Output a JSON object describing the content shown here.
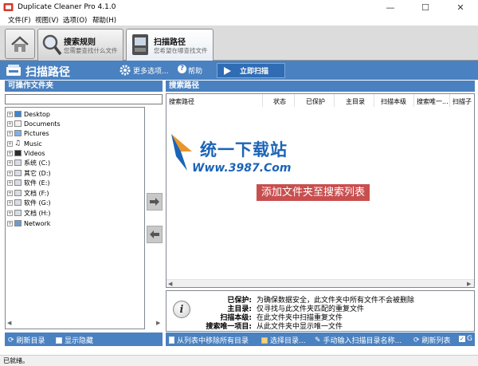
{
  "window": {
    "title": "Duplicate Cleaner Pro 4.1.0",
    "controls": [
      "—",
      "☐",
      "✕"
    ]
  },
  "menu": [
    "文件(F)",
    "视图(V)",
    "选项(O)",
    "帮助(H)"
  ],
  "ribbon": {
    "tabs": [
      {
        "title": "搜索规则",
        "subtitle": "您需要查找什么文件"
      },
      {
        "title": "扫描路径",
        "subtitle": "您希望在哪查找文件"
      }
    ]
  },
  "command_bar": {
    "title": "扫描路径",
    "more_options": "更多选项...",
    "help": "帮助",
    "scan_button": "立即扫描"
  },
  "left_panel": {
    "header": "可操作文件夹",
    "search_value": "",
    "tree": [
      "Desktop",
      "Documents",
      "Pictures",
      "Music",
      "Videos",
      "系统 (C:)",
      "其它 (D:)",
      "软件 (E:)",
      "文档 (F:)",
      "软件 (G:)",
      "文档 (H:)",
      "Network"
    ]
  },
  "right_panel": {
    "header": "搜索路径",
    "columns": [
      "搜索路径",
      "状态",
      "已保护",
      "主目录",
      "扫描本级",
      "搜索唯一...",
      "扫描子"
    ],
    "hint": "添加文件夹至搜索列表"
  },
  "watermark": {
    "name": "统一下载站",
    "url": "Www.3987.Com"
  },
  "info": {
    "items": [
      {
        "key": "已保护:",
        "value": "为确保数据安全，此文件夹中所有文件不会被删除"
      },
      {
        "key": "主目录:",
        "value": "仅寻找与此文件夹匹配的重复文件"
      },
      {
        "key": "扫描本级:",
        "value": "在此文件夹中扫描重复文件"
      },
      {
        "key": "搜索唯一项目:",
        "value": "从此文件夹中显示唯一文件"
      }
    ]
  },
  "bottom_left": {
    "refresh": "刷新目录",
    "show_hidden": "显示隐藏"
  },
  "bottom_right": {
    "remove_all": "从列表中移除所有目录",
    "choose": "选择目录...",
    "manual": "手动输入扫描目录名称...",
    "refresh_list": "刷新列表",
    "trailing": "G"
  },
  "status": "已就绪。",
  "colors": {
    "accent": "#4a81c0",
    "hint": "#c94f4f",
    "watermark": "#1b64b8"
  }
}
